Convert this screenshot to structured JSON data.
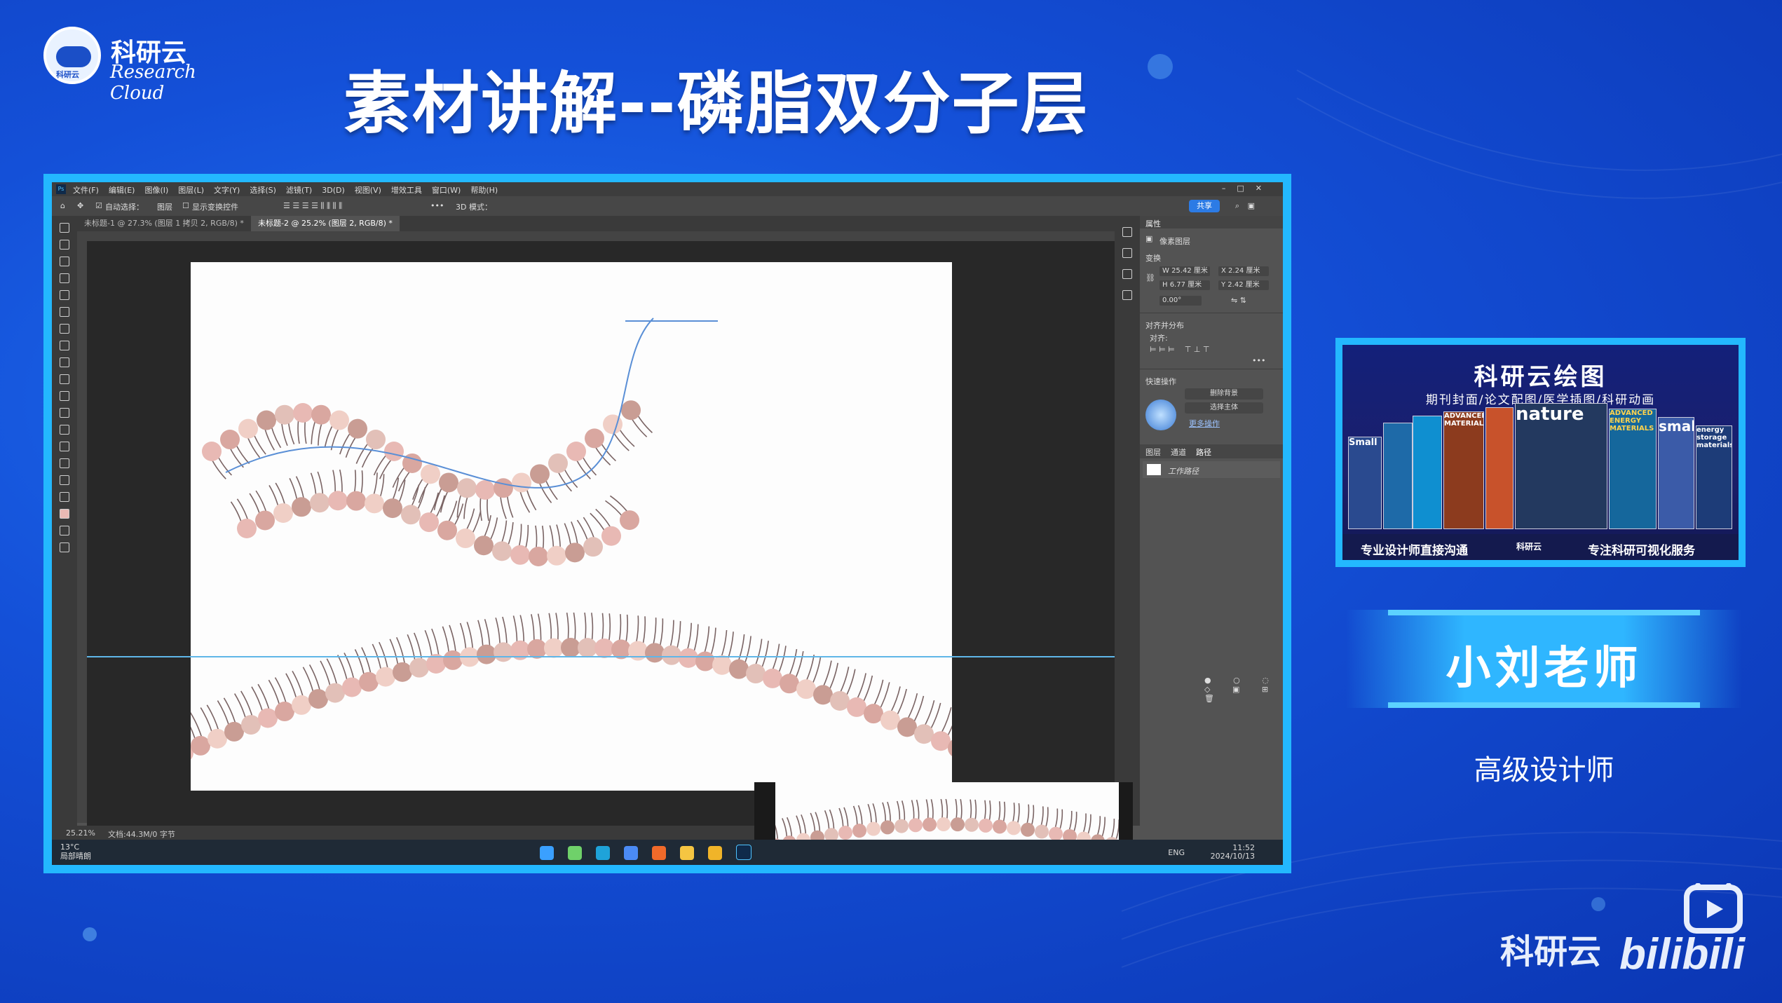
{
  "header": {
    "logo_cn": "科研云",
    "logo_en": "Research Cloud",
    "logo_badge": "科研云",
    "title": "素材讲解--磷脂双分子层"
  },
  "photoshop": {
    "menu": [
      "文件(F)",
      "编辑(E)",
      "图像(I)",
      "图层(L)",
      "文字(Y)",
      "选择(S)",
      "滤镜(T)",
      "3D(D)",
      "视图(V)",
      "增效工具",
      "窗口(W)",
      "帮助(H)"
    ],
    "ps_logo": "Ps",
    "options": {
      "auto_select": "自动选择：",
      "layer": "图层",
      "transform_controls": "显示变换控件",
      "mode3d": "3D 模式：",
      "share": "共享"
    },
    "tabs": [
      "未标题-1 @ 27.3% (图层 1 拷贝 2, RGB/8) *",
      "未标题-2 @ 25.2% (图层 2, RGB/8) *"
    ],
    "status": {
      "zoom": "25.21%",
      "doc": "文档:44.3M/0 字节"
    },
    "panel": {
      "header": "属性",
      "layer_type": "像素图层",
      "transform_title": "变换",
      "w": "W  25.42 厘米",
      "x": "X  2.24 厘米",
      "h": "H  6.77 厘米",
      "y": "Y  2.42 厘米",
      "angle": "0.00°",
      "align_title": "对齐并分布",
      "align_sub": "对齐:",
      "quick_title": "快速操作",
      "quick_btn1": "删除背景",
      "quick_btn2": "选择主体",
      "quick_more": "更多操作",
      "tabs": [
        "图层",
        "通道",
        "路径"
      ],
      "path_name": "工作路径"
    },
    "taskbar": {
      "temp": "13°C",
      "weather": "局部晴朗",
      "lang": "ENG",
      "time": "11:52",
      "date": "2024/10/13"
    }
  },
  "ad": {
    "title": "科研云绘图",
    "subtitle": "期刊封面/论文配图/医学插图/科研动画",
    "bottom_left": "专业设计师直接沟通",
    "bottom_right": "专注科研可视化服务",
    "journals": [
      "Small",
      "nature",
      "ADVANCED MATERIALS",
      "ADVANCED ENERGY MATERIALS",
      "small",
      "energy storage materials"
    ]
  },
  "presenter": {
    "name": "小刘老师",
    "role": "高级设计师"
  },
  "watermark": {
    "brand": "科研云",
    "platform": "bilibili"
  },
  "colors": {
    "frame": "#23b8ff",
    "background": "#1450d8",
    "lipid_heads": [
      "#e8b9b4",
      "#d9a7a0",
      "#f0cfc6",
      "#c99d94",
      "#e2c0b8"
    ]
  }
}
